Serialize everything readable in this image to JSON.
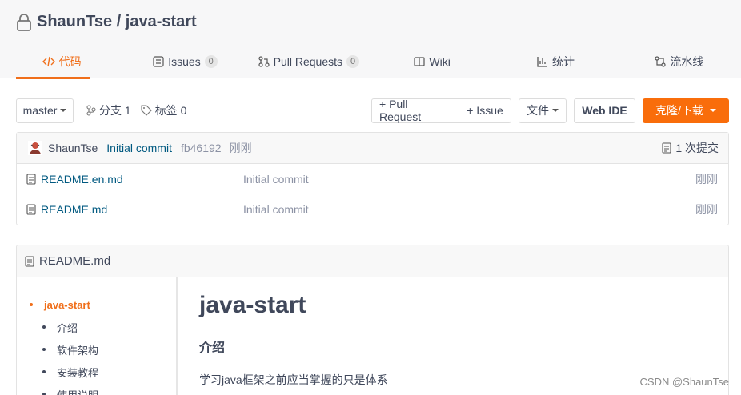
{
  "repo": {
    "title": "ShaunTse / java-start"
  },
  "tabs": [
    {
      "label": "代码",
      "icon": "code-icon",
      "active": true
    },
    {
      "label": "Issues",
      "icon": "issue-icon",
      "count": "0"
    },
    {
      "label": "Pull Requests",
      "icon": "pull-request-icon",
      "count": "0"
    },
    {
      "label": "Wiki",
      "icon": "wiki-icon"
    },
    {
      "label": "统计",
      "icon": "chart-icon"
    },
    {
      "label": "流水线",
      "icon": "pipeline-icon"
    }
  ],
  "toolbar": {
    "branch": "master",
    "branches": "分支 1",
    "tags": "标签 0",
    "pull_request": "+ Pull Request",
    "issue": "+ Issue",
    "file": "文件",
    "web_ide": "Web IDE",
    "clone": "克隆/下载"
  },
  "commit": {
    "author": "ShaunTse",
    "message": "Initial commit",
    "sha": "fb46192",
    "time": "刚刚",
    "count": "1 次提交"
  },
  "files": [
    {
      "name": "README.en.md",
      "message": "Initial commit",
      "time": "刚刚"
    },
    {
      "name": "README.md",
      "message": "Initial commit",
      "time": "刚刚"
    }
  ],
  "readme": {
    "filename": "README.md",
    "toc": [
      "java-start",
      "介绍",
      "软件架构",
      "安装教程",
      "使用说明"
    ],
    "h1": "java-start",
    "h2": "介绍",
    "paragraph": "学习java框架之前应当掌握的只是体系"
  },
  "watermark": "CSDN @ShaunTse",
  "colors": {
    "accent": "#f06f1b",
    "link": "#005980",
    "clone_button": "#f96d0b"
  }
}
